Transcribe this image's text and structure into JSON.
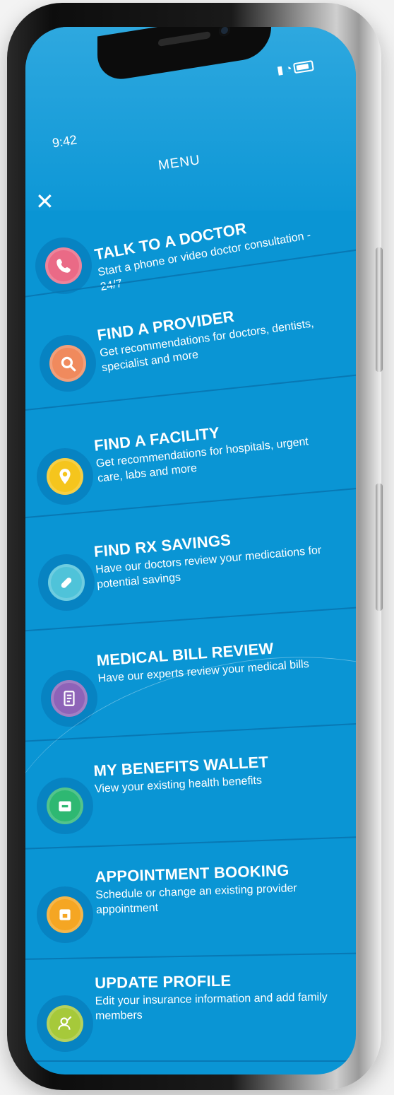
{
  "status": {
    "time": "9:42"
  },
  "header": {
    "title": "MENU",
    "close_glyph": "✕"
  },
  "menu_items": [
    {
      "title": "TALK TO A DOCTOR",
      "desc": "Start a phone or video doctor consultation - 24/7",
      "icon": "phone-icon",
      "color": "#ea6a86"
    },
    {
      "title": "FIND A PROVIDER",
      "desc": "Get recommendations for doctors, dentists, specialist and more",
      "icon": "search-icon",
      "color": "#f08a5d"
    },
    {
      "title": "FIND A FACILITY",
      "desc": "Get recommendations for hospitals, urgent care, labs and more",
      "icon": "location-pin-icon",
      "color": "#f5c51d"
    },
    {
      "title": "FIND RX SAVINGS",
      "desc": "Have our doctors review your medications for potential savings",
      "icon": "pill-icon",
      "color": "#4fc3d9"
    },
    {
      "title": "MEDICAL BILL REVIEW",
      "desc": "Have our experts review your medical bills",
      "icon": "bill-icon",
      "color": "#8e63b8"
    },
    {
      "title": "MY BENEFITS WALLET",
      "desc": "View your existing health benefits",
      "icon": "wallet-icon",
      "color": "#2eb872"
    },
    {
      "title": "APPOINTMENT BOOKING",
      "desc": "Schedule or change an existing provider appointment",
      "icon": "calendar-icon",
      "color": "#f5a623"
    },
    {
      "title": "UPDATE PROFILE",
      "desc": "Edit your insurance information and add family members",
      "icon": "profile-edit-icon",
      "color": "#a6c93a"
    }
  ]
}
